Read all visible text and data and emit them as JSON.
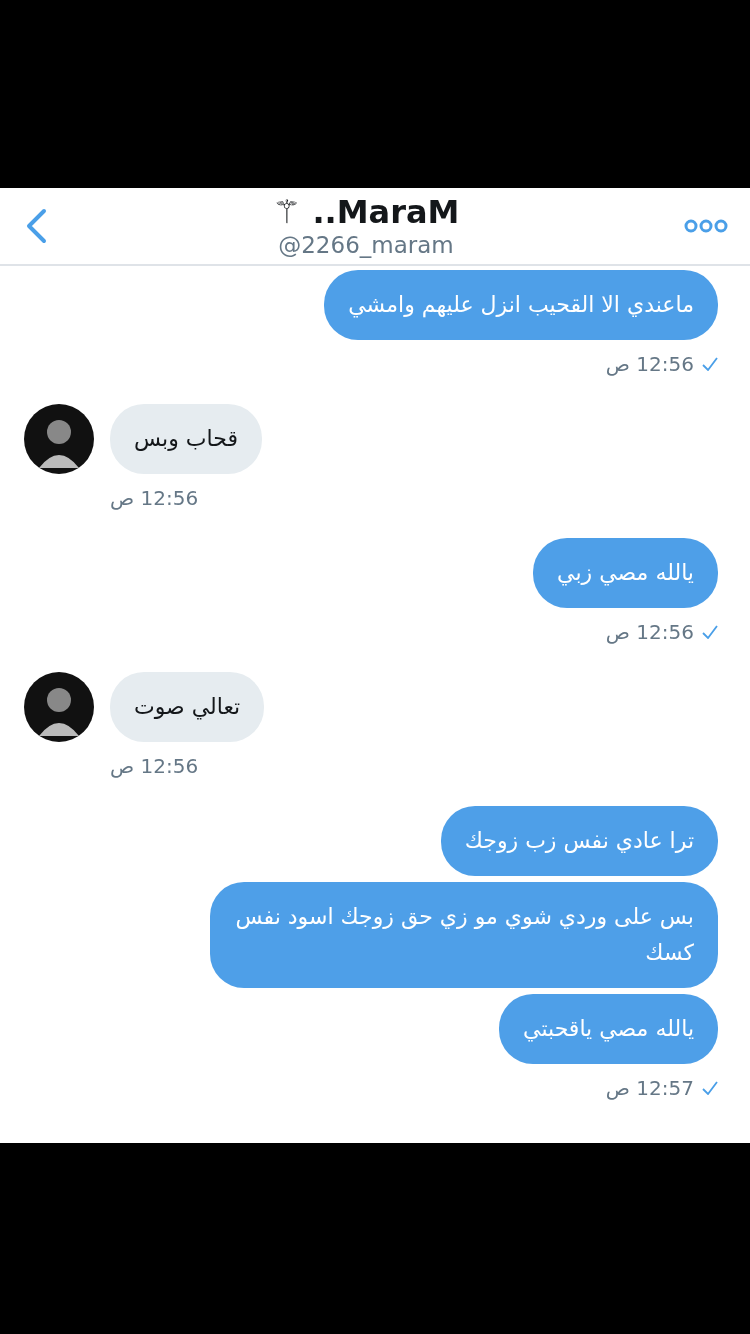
{
  "header": {
    "title": "⚚ ..MaraM",
    "handle": "@2266_maram"
  },
  "groups": [
    {
      "kind": "sent",
      "messages": [
        "ماعندي الا القحيب انزل عليهم وامشي"
      ],
      "time": "12:56 ص",
      "read": true
    },
    {
      "kind": "received",
      "messages": [
        "قحاب وبس"
      ],
      "time": "12:56 ص"
    },
    {
      "kind": "sent",
      "messages": [
        "يالله مصي زبي"
      ],
      "time": "12:56 ص",
      "read": true
    },
    {
      "kind": "received",
      "messages": [
        "تعالي صوت"
      ],
      "time": "12:56 ص"
    },
    {
      "kind": "sent",
      "messages": [
        "ترا عادي نفس زب زوجك",
        "بس على وردي شوي مو زي حق زوجك اسود نفس كسك",
        "يالله مصي ياقحبتي"
      ],
      "time": "12:57 ص",
      "read": true
    }
  ]
}
